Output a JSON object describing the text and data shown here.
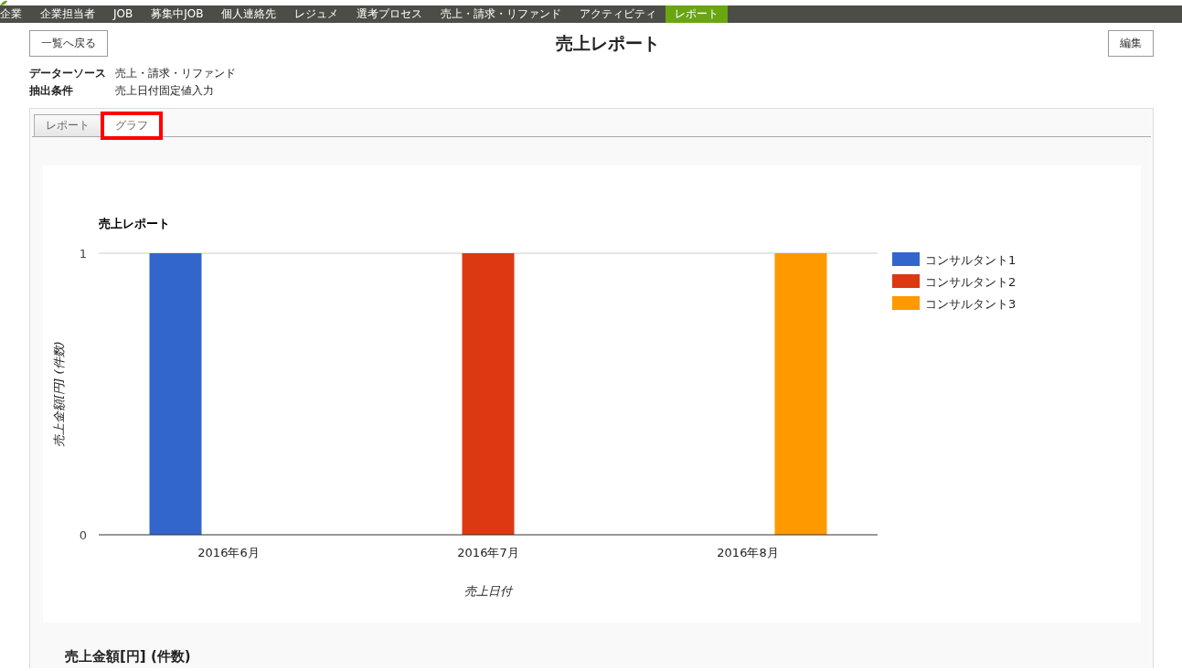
{
  "nav": [
    {
      "label": "企業",
      "selected": false
    },
    {
      "label": "企業担当者",
      "selected": false
    },
    {
      "label": "JOB",
      "selected": false
    },
    {
      "label": "募集中JOB",
      "selected": false
    },
    {
      "label": "個人連絡先",
      "selected": false
    },
    {
      "label": "レジュメ",
      "selected": false
    },
    {
      "label": "選考プロセス",
      "selected": false
    },
    {
      "label": "売上・請求・リファンド",
      "selected": false
    },
    {
      "label": "アクティビティ",
      "selected": false
    },
    {
      "label": "レポート",
      "selected": true
    }
  ],
  "back_button": "一覧へ戻る",
  "title": "売上レポート",
  "edit_button": "編集",
  "meta": [
    {
      "label": "データーソース",
      "value": "売上・請求・リファンド"
    },
    {
      "label": "抽出条件",
      "value": "売上日付固定値入力"
    }
  ],
  "tabs": [
    {
      "label": "レポート",
      "selected": false,
      "highlighted": false
    },
    {
      "label": "グラフ",
      "selected": true,
      "highlighted": true
    }
  ],
  "chart_data": {
    "type": "bar",
    "title": "売上レポート",
    "xlabel": "売上日付",
    "ylabel": "売上金額[円] (件数)",
    "categories": [
      "2016年6月",
      "2016年7月",
      "2016年8月"
    ],
    "series": [
      {
        "name": "コンサルタント1",
        "color": "#3366cc",
        "values": [
          1,
          0,
          0
        ]
      },
      {
        "name": "コンサルタント2",
        "color": "#dc3912",
        "values": [
          0,
          1,
          0
        ]
      },
      {
        "name": "コンサルタント3",
        "color": "#ff9900",
        "values": [
          0,
          0,
          1
        ]
      }
    ],
    "ylim": [
      0,
      1
    ],
    "yticks": [
      0,
      1
    ],
    "legend": true
  },
  "table_title": "売上金額[円] (件数)"
}
